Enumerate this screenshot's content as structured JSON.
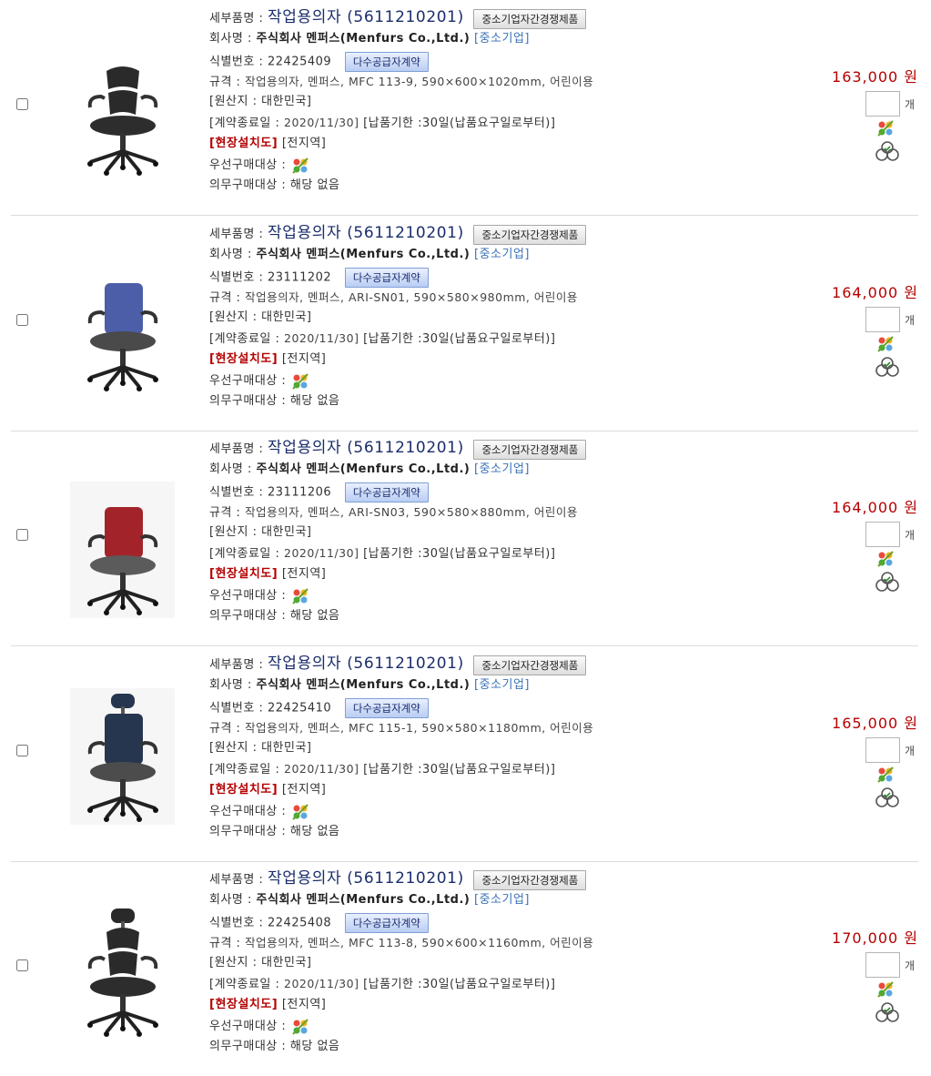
{
  "labels": {
    "detail_name": "세부품명 :",
    "company": "회사명 :",
    "sme_tag": "[중소기업]",
    "id_no": "식별번호 :",
    "spec": "규격 :",
    "origin": "[원산지 : 대한민국]",
    "contract_end": "[계약종료일 :",
    "delivery": "[납품기한 :30일(납품요구일로부터)]",
    "onsite": "[현장설치도]",
    "region": "[전지역]",
    "priority": "우선구매대상 :",
    "mandatory": "의무구매대상 : 해당 없음",
    "unit": "개"
  },
  "badges": {
    "sme_competition": "중소기업자간경쟁제품",
    "mas": "다수공급자계약"
  },
  "colors": {
    "price": "#b40000",
    "title": "#1b2d6b",
    "sme_link": "#3a72b5",
    "onsite": "#b40000"
  },
  "icon_names": [
    "priority-purchase-icon",
    "certification-icon"
  ],
  "products": [
    {
      "name": "작업용의자 (5611210201)",
      "company": "주식회사 멘퍼스(Menfurs Co.,Ltd.)",
      "id_no": "22425409",
      "spec": "작업용의자, 멘퍼스, MFC 113-9, 590×600×1020mm, 어린이용",
      "contract_end": "2020/11/30]",
      "price": "163,000 원",
      "chair": "black-dual-back"
    },
    {
      "name": "작업용의자 (5611210201)",
      "company": "주식회사 멘퍼스(Menfurs Co.,Ltd.)",
      "id_no": "23111202",
      "spec": "작업용의자, 멘퍼스, ARI-SN01, 590×580×980mm, 어린이용",
      "contract_end": "2020/11/30]",
      "price": "164,000 원",
      "chair": "blue-back"
    },
    {
      "name": "작업용의자 (5611210201)",
      "company": "주식회사 멘퍼스(Menfurs Co.,Ltd.)",
      "id_no": "23111206",
      "spec": "작업용의자, 멘퍼스, ARI-SN03, 590×580×880mm, 어린이용",
      "contract_end": "2020/11/30]",
      "price": "164,000 원",
      "chair": "red-back"
    },
    {
      "name": "작업용의자 (5611210201)",
      "company": "주식회사 멘퍼스(Menfurs Co.,Ltd.)",
      "id_no": "22425410",
      "spec": "작업용의자, 멘퍼스, MFC 115-1, 590×580×1180mm, 어린이용",
      "contract_end": "2020/11/30]",
      "price": "165,000 원",
      "chair": "navy-headrest"
    },
    {
      "name": "작업용의자 (5611210201)",
      "company": "주식회사 멘퍼스(Menfurs Co.,Ltd.)",
      "id_no": "22425408",
      "spec": "작업용의자, 멘퍼스, MFC 113-8, 590×600×1160mm, 어린이용",
      "contract_end": "2020/11/30]",
      "price": "170,000 원",
      "chair": "black-headrest"
    }
  ]
}
